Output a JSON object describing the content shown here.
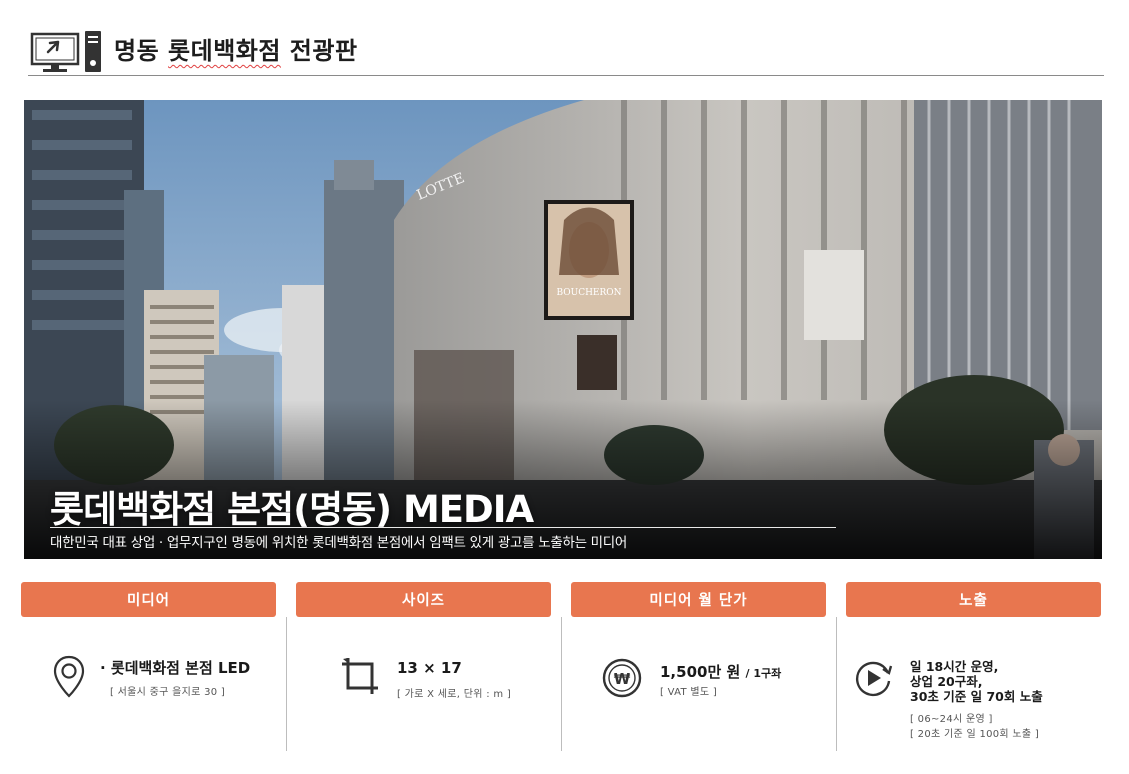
{
  "header": {
    "title_a": "명동",
    "title_b": "롯데백화점",
    "title_c": "전광판"
  },
  "hero": {
    "title": "롯데백화점 본점(명동) MEDIA",
    "subtitle": "대한민국 대표 상업 · 업무지구인 명동에 위치한 롯데백화점 본점에서 임팩트 있게 광고를 노출하는 미디어",
    "sign_lotte": "LOTTE",
    "sign_brand": "BOUCHERON"
  },
  "columns": [
    {
      "label": "미디어",
      "icon": "location-pin-icon",
      "main": "· 롯데백화점 본점 LED",
      "notes": [
        "[ 서울시 중구 을지로 30 ]"
      ]
    },
    {
      "label": "사이즈",
      "icon": "resize-icon",
      "main": "13 × 17",
      "notes": [
        "[ 가로 X 세로, 단위 : m ]"
      ]
    },
    {
      "label": "미디어 월 단가",
      "icon": "won-coin-icon",
      "main": "1,500만 원",
      "main_suffix": "/ 1구좌",
      "notes": [
        "[ VAT 별도 ]"
      ]
    },
    {
      "label": "노출",
      "icon": "play-cycle-icon",
      "main_lines": [
        "일 18시간 운영,",
        "상업 20구좌,",
        "30초 기준 일 70회 노출"
      ],
      "notes": [
        "[ 06~24시 운영 ]",
        "[ 20초 기준 일 100회 노출 ]"
      ]
    }
  ],
  "colors": {
    "accent": "#e8764f",
    "title": "#1d1d1d"
  }
}
